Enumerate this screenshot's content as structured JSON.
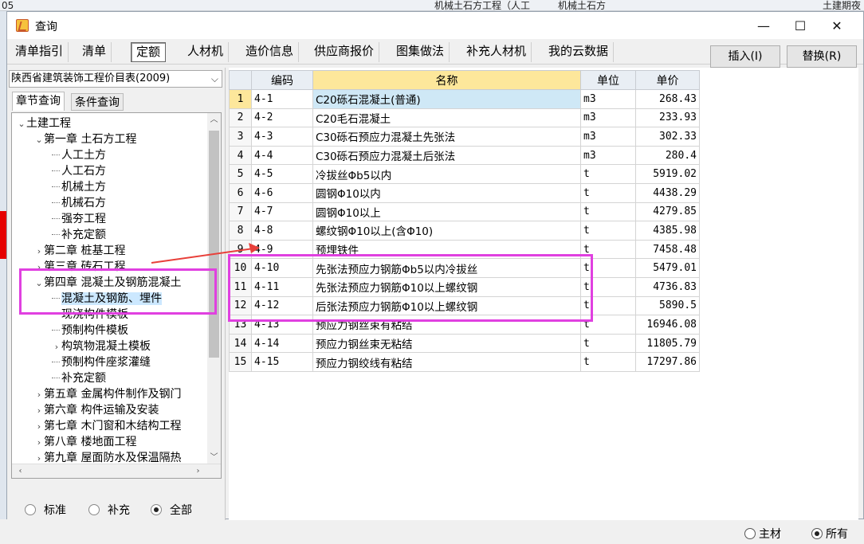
{
  "background": {
    "top_cells": [
      {
        "text": "05"
      },
      {
        "text": "机械土石方工程（人工"
      },
      {
        "text": "机械土石方"
      },
      {
        "text": "土建期夜"
      }
    ],
    "bottom_radios": [
      {
        "label": "主材",
        "checked": false
      },
      {
        "label": "所有",
        "checked": true
      }
    ]
  },
  "window": {
    "title": "查询",
    "minimize_icon": "minimize-icon",
    "maximize_icon": "maximize-icon",
    "close_icon": "close-icon"
  },
  "tabs": [
    {
      "label": "清单指引",
      "active": false
    },
    {
      "label": "清单",
      "active": false
    },
    {
      "label": "定额",
      "active": true
    },
    {
      "label": "人材机",
      "active": false
    },
    {
      "label": "造价信息",
      "active": false
    },
    {
      "label": "供应商报价",
      "active": false
    },
    {
      "label": "图集做法",
      "active": false
    },
    {
      "label": "补充人材机",
      "active": false
    },
    {
      "label": "我的云数据",
      "active": false
    }
  ],
  "actions": {
    "insert_label": "插入(I)",
    "replace_label": "替换(R)"
  },
  "left": {
    "library_select": "陕西省建筑装饰工程价目表(2009)",
    "subtabs": [
      "章节查询",
      "条件查询"
    ],
    "tree": [
      {
        "label": "土建工程",
        "level": 0,
        "toggle": "⌄"
      },
      {
        "label": "第一章  土石方工程",
        "level": 1,
        "toggle": "⌄"
      },
      {
        "label": "人工土方",
        "level": 2,
        "toggle": ""
      },
      {
        "label": "人工石方",
        "level": 2,
        "toggle": ""
      },
      {
        "label": "机械土方",
        "level": 2,
        "toggle": ""
      },
      {
        "label": "机械石方",
        "level": 2,
        "toggle": ""
      },
      {
        "label": "强夯工程",
        "level": 2,
        "toggle": ""
      },
      {
        "label": "补充定额",
        "level": 2,
        "toggle": ""
      },
      {
        "label": "第二章  桩基工程",
        "level": 1,
        "toggle": "›"
      },
      {
        "label": "第三章  砖石工程",
        "level": 1,
        "toggle": "›"
      },
      {
        "label": "第四章  混凝土及钢筋混凝土",
        "level": 1,
        "toggle": "⌄"
      },
      {
        "label": "混凝土及钢筋、埋件",
        "level": 2,
        "toggle": "",
        "selected": true
      },
      {
        "label": "现浇构件模板",
        "level": 2,
        "toggle": ""
      },
      {
        "label": "预制构件模板",
        "level": 2,
        "toggle": ""
      },
      {
        "label": "构筑物混凝土模板",
        "level": 2,
        "toggle": "›"
      },
      {
        "label": "预制构件座浆灌缝",
        "level": 2,
        "toggle": ""
      },
      {
        "label": "补充定额",
        "level": 2,
        "toggle": ""
      },
      {
        "label": "第五章  金属构件制作及钢门",
        "level": 1,
        "toggle": "›"
      },
      {
        "label": "第六章  构件运输及安装",
        "level": 1,
        "toggle": "›"
      },
      {
        "label": "第七章  木门窗和木结构工程",
        "level": 1,
        "toggle": "›"
      },
      {
        "label": "第八章  楼地面工程",
        "level": 1,
        "toggle": "›"
      },
      {
        "label": "第九章  屋面防水及保温隔热",
        "level": 1,
        "toggle": "›"
      }
    ],
    "filter_radios": [
      {
        "label": "标准",
        "checked": false
      },
      {
        "label": "补充",
        "checked": false
      },
      {
        "label": "全部",
        "checked": true
      }
    ]
  },
  "grid": {
    "headers": [
      "",
      "编码",
      "名称",
      "单位",
      "单价"
    ],
    "rows": [
      {
        "idx": "1",
        "code": "4-1",
        "name": "C20砾石混凝土(普通)",
        "unit": "m3",
        "price": "268.43"
      },
      {
        "idx": "2",
        "code": "4-2",
        "name": "C20毛石混凝土",
        "unit": "m3",
        "price": "233.93"
      },
      {
        "idx": "3",
        "code": "4-3",
        "name": "C30砾石预应力混凝土先张法",
        "unit": "m3",
        "price": "302.33"
      },
      {
        "idx": "4",
        "code": "4-4",
        "name": "C30砾石预应力混凝土后张法",
        "unit": "m3",
        "price": "280.4"
      },
      {
        "idx": "5",
        "code": "4-5",
        "name": "冷拔丝Φb5以内",
        "unit": "t",
        "price": "5919.02"
      },
      {
        "idx": "6",
        "code": "4-6",
        "name": "圆钢Φ10以内",
        "unit": "t",
        "price": "4438.29"
      },
      {
        "idx": "7",
        "code": "4-7",
        "name": "圆钢Φ10以上",
        "unit": "t",
        "price": "4279.85"
      },
      {
        "idx": "8",
        "code": "4-8",
        "name": "螺纹钢Φ10以上(含Φ10)",
        "unit": "t",
        "price": "4385.98"
      },
      {
        "idx": "9",
        "code": "4-9",
        "name": "预埋铁件",
        "unit": "t",
        "price": "7458.48"
      },
      {
        "idx": "10",
        "code": "4-10",
        "name": "先张法预应力钢筋Φb5以内冷拔丝",
        "unit": "t",
        "price": "5479.01"
      },
      {
        "idx": "11",
        "code": "4-11",
        "name": "先张法预应力钢筋Φ10以上螺纹钢",
        "unit": "t",
        "price": "4736.83"
      },
      {
        "idx": "12",
        "code": "4-12",
        "name": "后张法预应力钢筋Φ10以上螺纹钢",
        "unit": "t",
        "price": "5890.5"
      },
      {
        "idx": "13",
        "code": "4-13",
        "name": "预应力钢丝束有粘结",
        "unit": "t",
        "price": "16946.08"
      },
      {
        "idx": "14",
        "code": "4-14",
        "name": "预应力钢丝束无粘结",
        "unit": "t",
        "price": "11805.79"
      },
      {
        "idx": "15",
        "code": "4-15",
        "name": "预应力钢绞线有粘结",
        "unit": "t",
        "price": "17297.86"
      }
    ]
  },
  "colors": {
    "highlight_box": "#e040e0",
    "arrow": "#e8403a",
    "selected_header": "#fde79b"
  }
}
